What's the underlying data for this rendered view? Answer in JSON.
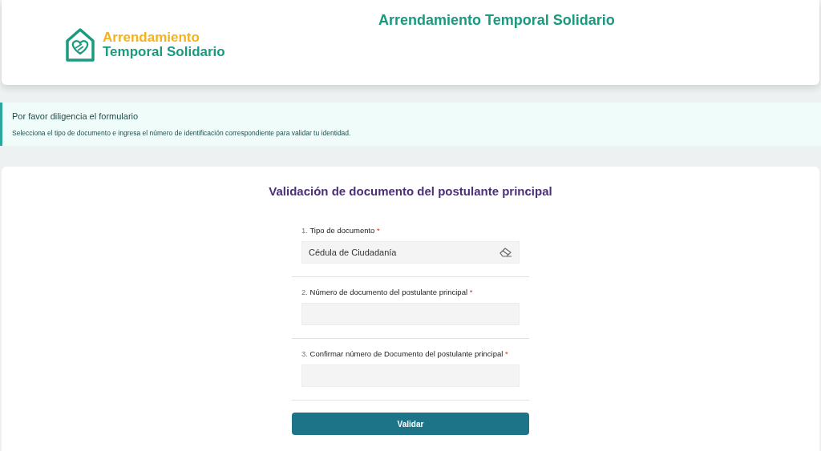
{
  "header": {
    "logo_line_1": "Arrendamiento",
    "logo_line_2": "Temporal Solidario",
    "title": "Arrendamiento Temporal Solidario"
  },
  "notice": {
    "title": "Por favor diligencia el formulario",
    "text": "Selecciona el tipo de documento e ingresa el número de identificación correspondiente para validar tu identidad."
  },
  "form": {
    "title": "Validación de documento del postulante principal",
    "fields": [
      {
        "kind": "select",
        "number": "1.",
        "label": "Tipo de documento",
        "marker": "*",
        "value": "Cédula de Ciudadanía"
      },
      {
        "kind": "text",
        "number": "2.",
        "label": "Número de documento del postulante principal",
        "marker": "*"
      },
      {
        "kind": "text",
        "number": "3.",
        "label": "Confirmar número de Documento del postulante principal",
        "marker": "*"
      }
    ],
    "button": "Validar"
  }
}
